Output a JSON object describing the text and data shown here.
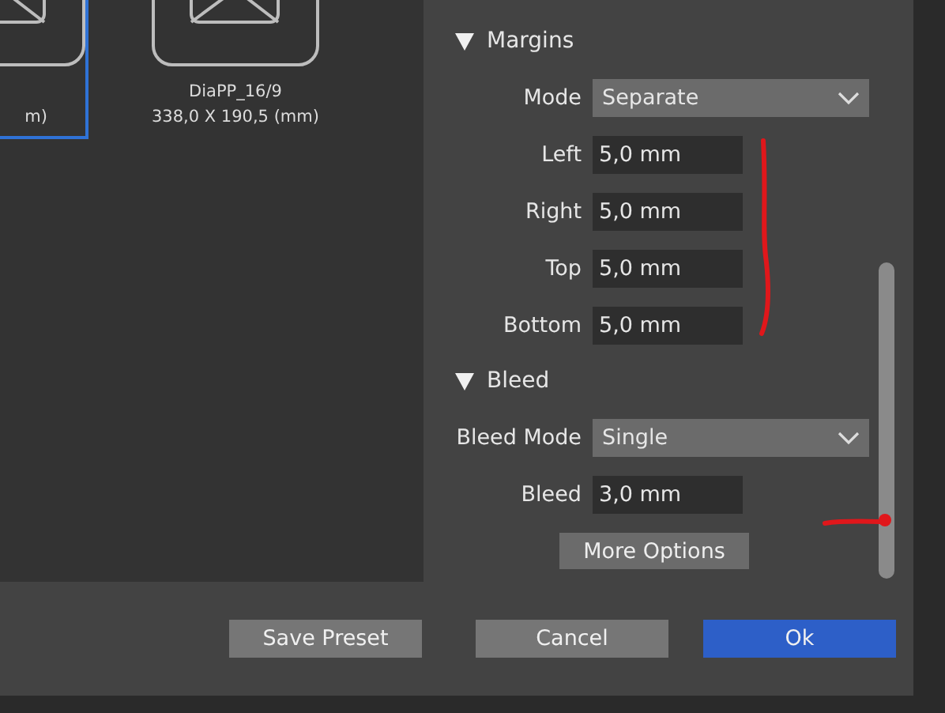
{
  "presets": [
    {
      "dimensions": "m)",
      "selected": true
    },
    {
      "name": "DiaPP_16/9",
      "dimensions": "338,0 X 190,5 (mm)",
      "selected": false
    }
  ],
  "sections": [
    {
      "title": "Margins",
      "expanded": true,
      "fields": [
        {
          "label": "Mode",
          "kind": "dropdown",
          "value": "Separate"
        },
        {
          "label": "Left",
          "kind": "input",
          "value": "5,0 mm"
        },
        {
          "label": "Right",
          "kind": "input",
          "value": "5,0 mm"
        },
        {
          "label": "Top",
          "kind": "input",
          "value": "5,0 mm"
        },
        {
          "label": "Bottom",
          "kind": "input",
          "value": "5,0 mm"
        }
      ]
    },
    {
      "title": "Bleed",
      "expanded": true,
      "fields": [
        {
          "label": "Bleed Mode",
          "kind": "dropdown",
          "value": "Single"
        },
        {
          "label": "Bleed",
          "kind": "input",
          "value": "3,0 mm"
        }
      ]
    }
  ],
  "more_options": "More Options",
  "buttons": [
    {
      "label": "Save Preset",
      "kind": "normal"
    },
    {
      "label": "Cancel",
      "kind": "normal"
    },
    {
      "label": "Ok",
      "kind": "primary"
    }
  ]
}
